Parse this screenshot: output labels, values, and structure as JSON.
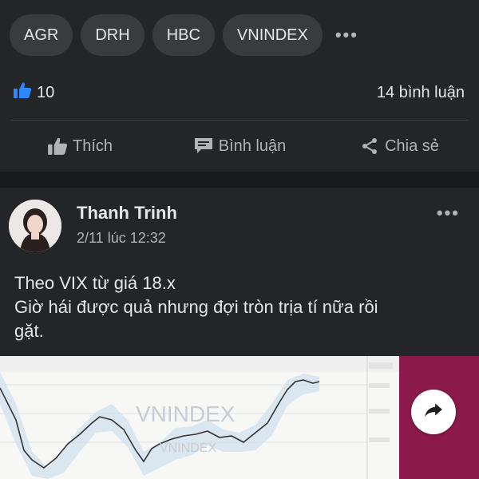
{
  "tags": [
    "AGR",
    "DRH",
    "HBC",
    "VNINDEX"
  ],
  "tags_more": "•••",
  "reactions": {
    "like_count": "10",
    "comment_count": "14 bình luận"
  },
  "actions": {
    "like": "Thích",
    "comment": "Bình luận",
    "share": "Chia sẻ"
  },
  "post": {
    "author": "Thanh Trinh",
    "time": "2/11 lúc 12:32",
    "more": "•••",
    "text_line1": "Theo VIX từ giá 18.x",
    "text_line2": "Giờ hái được quả nhưng đợi tròn trịa tí nữa rồi",
    "text_line3": "gặt."
  },
  "chart_image": {
    "watermark": "VNINDEX"
  },
  "colors": {
    "background": "#242526",
    "accent_like": "#2d88ff",
    "chart_side": "#8b1a4b"
  }
}
